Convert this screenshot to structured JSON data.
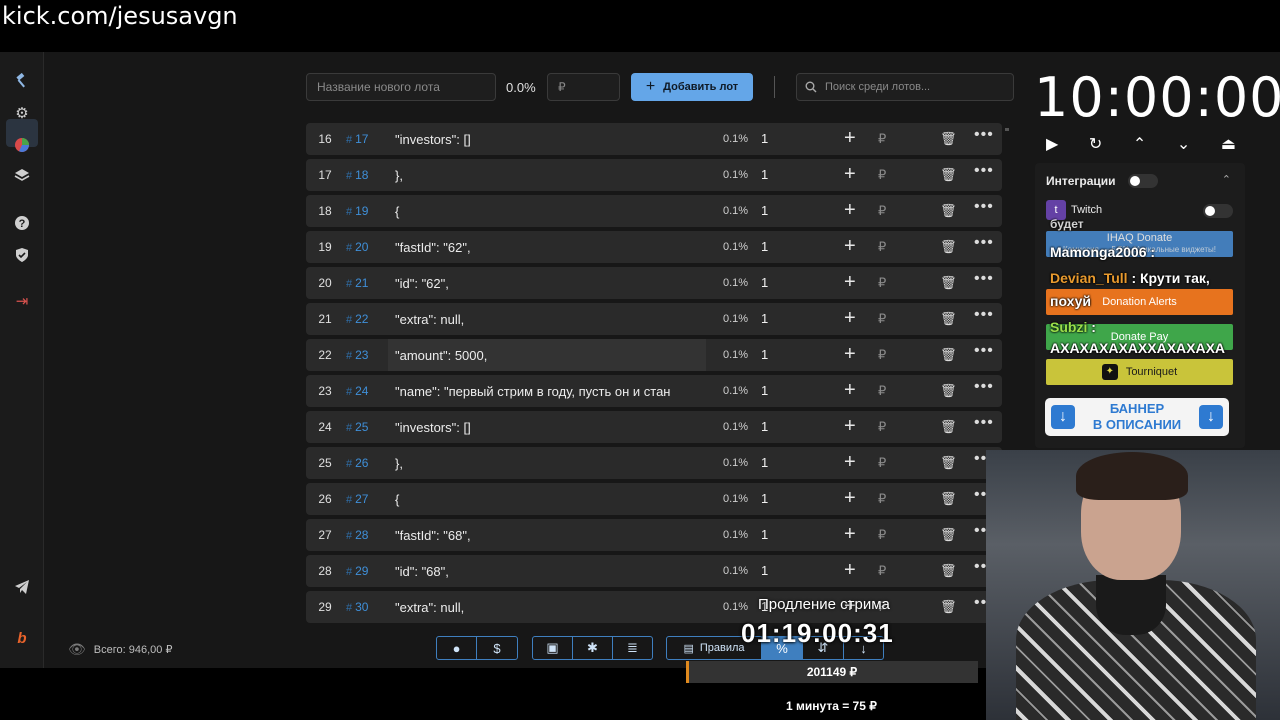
{
  "browser": {
    "url": "kick.com/jesusavgn"
  },
  "toolbar": {
    "lot_name_placeholder": "Название нового лота",
    "percent": "0.0%",
    "amount_placeholder": "₽",
    "add_label": "Добавить лот",
    "search_placeholder": "Поиск среди лотов..."
  },
  "lots": [
    {
      "idx": "16",
      "fid": "17",
      "name": "\"investors\": []",
      "pct": "0.1%",
      "amount": "1"
    },
    {
      "idx": "17",
      "fid": "18",
      "name": "},",
      "pct": "0.1%",
      "amount": "1"
    },
    {
      "idx": "18",
      "fid": "19",
      "name": "{",
      "pct": "0.1%",
      "amount": "1"
    },
    {
      "idx": "19",
      "fid": "20",
      "name": "\"fastId\": \"62\",",
      "pct": "0.1%",
      "amount": "1"
    },
    {
      "idx": "20",
      "fid": "21",
      "name": "\"id\": \"62\",",
      "pct": "0.1%",
      "amount": "1"
    },
    {
      "idx": "21",
      "fid": "22",
      "name": "\"extra\": null,",
      "pct": "0.1%",
      "amount": "1"
    },
    {
      "idx": "22",
      "fid": "23",
      "name": "\"amount\": 5000,",
      "pct": "0.1%",
      "amount": "1"
    },
    {
      "idx": "23",
      "fid": "24",
      "name": "\"name\": \"первый стрим в году, пусть он и стан",
      "pct": "0.1%",
      "amount": "1"
    },
    {
      "idx": "24",
      "fid": "25",
      "name": "\"investors\": []",
      "pct": "0.1%",
      "amount": "1"
    },
    {
      "idx": "25",
      "fid": "26",
      "name": "},",
      "pct": "0.1%",
      "amount": "1"
    },
    {
      "idx": "26",
      "fid": "27",
      "name": "{",
      "pct": "0.1%",
      "amount": "1"
    },
    {
      "idx": "27",
      "fid": "28",
      "name": "\"fastId\": \"68\",",
      "pct": "0.1%",
      "amount": "1"
    },
    {
      "idx": "28",
      "fid": "29",
      "name": "\"id\": \"68\",",
      "pct": "0.1%",
      "amount": "1"
    },
    {
      "idx": "29",
      "fid": "30",
      "name": "\"extra\": null,",
      "pct": "0.1%",
      "amount": "1"
    }
  ],
  "row_symbols": {
    "hash": "#",
    "plus": "+",
    "rub": "₽",
    "delete": "🗑",
    "more": "•••"
  },
  "total": {
    "label": "Всего:",
    "value": "946,00 ₽"
  },
  "bottom": {
    "rules_label": "Правила",
    "percent_symbol": "%"
  },
  "timer": {
    "value": "10:00:00"
  },
  "integrations": {
    "title": "Интеграции",
    "twitch_label": "Twitch"
  },
  "alerts": [
    {
      "label": "IHAQ Donate",
      "color": "#4a8fd6"
    },
    {
      "label": "Donation Alerts",
      "color": "#e7731e"
    },
    {
      "label": "Donate Pay",
      "color": "#3fa64a"
    },
    {
      "label": "Tourniquet",
      "color": "#c9c43a"
    }
  ],
  "chat": {
    "l1": "будет",
    "l2": "Mamonga2006 :",
    "l3_user": "Devian_Tull",
    "l3_msg": ": Крути так,",
    "l4": "похуй",
    "l5_user": "Subzi",
    "l5_msg": ":",
    "l6": "АХАХАХАХАХХАХАХАХА",
    "alert_sub": "Комиссия — 5,5%. Уникальные виджеты!"
  },
  "banner": {
    "line1": "БАННЕР",
    "line2": "В ОПИСАНИИ"
  },
  "stream": {
    "extension_label": "Продление стрима",
    "extension_timer": "01:19:00:31",
    "goal_value": "201149 ₽",
    "goal_progress": 0.01,
    "rate": "1 минута = 75 ₽"
  }
}
